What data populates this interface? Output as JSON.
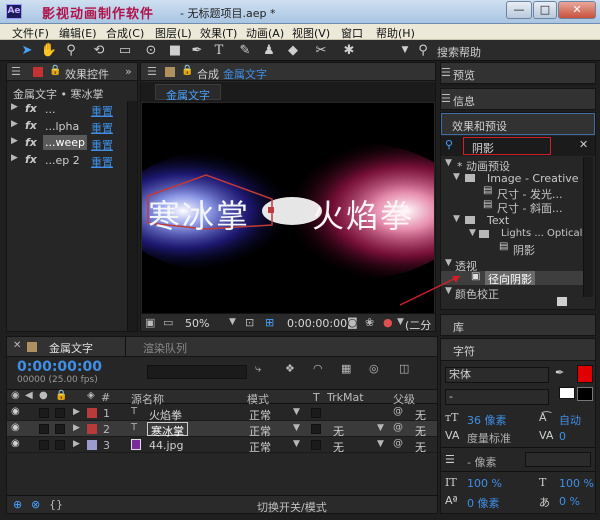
{
  "window": {
    "watermark": "影视动画制作软件",
    "doc_title": "- 无标题项目.aep *",
    "min": "—",
    "max": "□",
    "close": "✕"
  },
  "menu": [
    "文件(F)",
    "编辑(E)",
    "合成(C)",
    "图层(L)",
    "效果(T)",
    "动画(A)",
    "视图(V)",
    "窗口",
    "帮助(H)"
  ],
  "toolbar": {
    "search_help": "搜索帮助",
    "tools": [
      "selection-tool-icon",
      "hand-tool-icon",
      "zoom-tool-icon",
      "rotate-tool-icon",
      "camera-tool-icon",
      "pan-behind-icon",
      "rectangle-tool-icon",
      "pen-tool-icon",
      "type-tool-icon",
      "brush-tool-icon",
      "clone-stamp-icon",
      "eraser-tool-icon",
      "roto-brush-icon",
      "puppet-pin-icon"
    ]
  },
  "effects_panel": {
    "title": "效果控件",
    "subtitle": "金属文字 • 寒冰掌",
    "items": [
      {
        "fx": "fx",
        "name": "...",
        "reset": "重置"
      },
      {
        "fx": "fx",
        "name": "...lpha",
        "reset": "重置"
      },
      {
        "fx": "fx",
        "name": "...weep",
        "reset": "重置"
      },
      {
        "fx": "fx",
        "name": "...ep 2",
        "reset": "重置"
      }
    ]
  },
  "comp_panel": {
    "label": "合成",
    "name": "金属文字",
    "tab": "金属文字",
    "zoom": "50%",
    "timecode": "0:00:00:00",
    "res": "(二分",
    "text_left": "寒冰掌",
    "text_right": "火焰拳"
  },
  "right_panels": {
    "preview": "预览",
    "info": "信息",
    "effects_presets": "效果和预设",
    "search": "阴影",
    "library": "库",
    "character": "字符"
  },
  "presets_tree": [
    {
      "type": "folder",
      "label": "* 动画预设",
      "indent": 0
    },
    {
      "type": "folder",
      "label": "Image - Creative",
      "indent": 1
    },
    {
      "type": "item",
      "label": "尺寸 - 发光...",
      "indent": 2
    },
    {
      "type": "item",
      "label": "尺寸 - 斜面...",
      "indent": 2
    },
    {
      "type": "folder",
      "label": "Text",
      "indent": 1
    },
    {
      "type": "folder",
      "label": "Lights ... Optical",
      "indent": 2
    },
    {
      "type": "item",
      "label": "阴影",
      "indent": 3
    },
    {
      "type": "category",
      "label": "透视",
      "indent": 0
    },
    {
      "type": "effect",
      "label": "径向阴影",
      "indent": 1,
      "highlighted": true
    },
    {
      "type": "category",
      "label": "颜色校正",
      "indent": 0
    }
  ],
  "character": {
    "font": "宋体",
    "style": "-",
    "size": "36 像素",
    "leading": "自动",
    "tracking_label": "度量标准",
    "tracking": "0",
    "stroke": "- 像素",
    "vscale": "100 %",
    "hscale": "100 %",
    "baseline": "0 像素",
    "tsume": "0 %",
    "fill_color": "#e00000"
  },
  "timeline": {
    "tab": "金属文字",
    "render_tab": "渲染队列",
    "timecode": "0:00:00:00",
    "fps": "00000 (25.00 fps)",
    "headers": {
      "num": "#",
      "name": "源名称",
      "mode": "模式",
      "t": "T",
      "trkmat": "TrkMat",
      "parent": "父级"
    },
    "layers": [
      {
        "num": "1",
        "name": "火焰拳",
        "mode": "正常",
        "trkmat": "",
        "parent": "无",
        "color": "#b83a3a"
      },
      {
        "num": "2",
        "name": "寒冰掌",
        "mode": "正常",
        "trkmat": "无",
        "parent": "无",
        "color": "#b83a3a",
        "selected": true
      },
      {
        "num": "3",
        "name": "44.jpg",
        "mode": "正常",
        "trkmat": "无",
        "parent": "无",
        "color": "#9c9ccc"
      }
    ],
    "footer": "切换开关/模式"
  }
}
